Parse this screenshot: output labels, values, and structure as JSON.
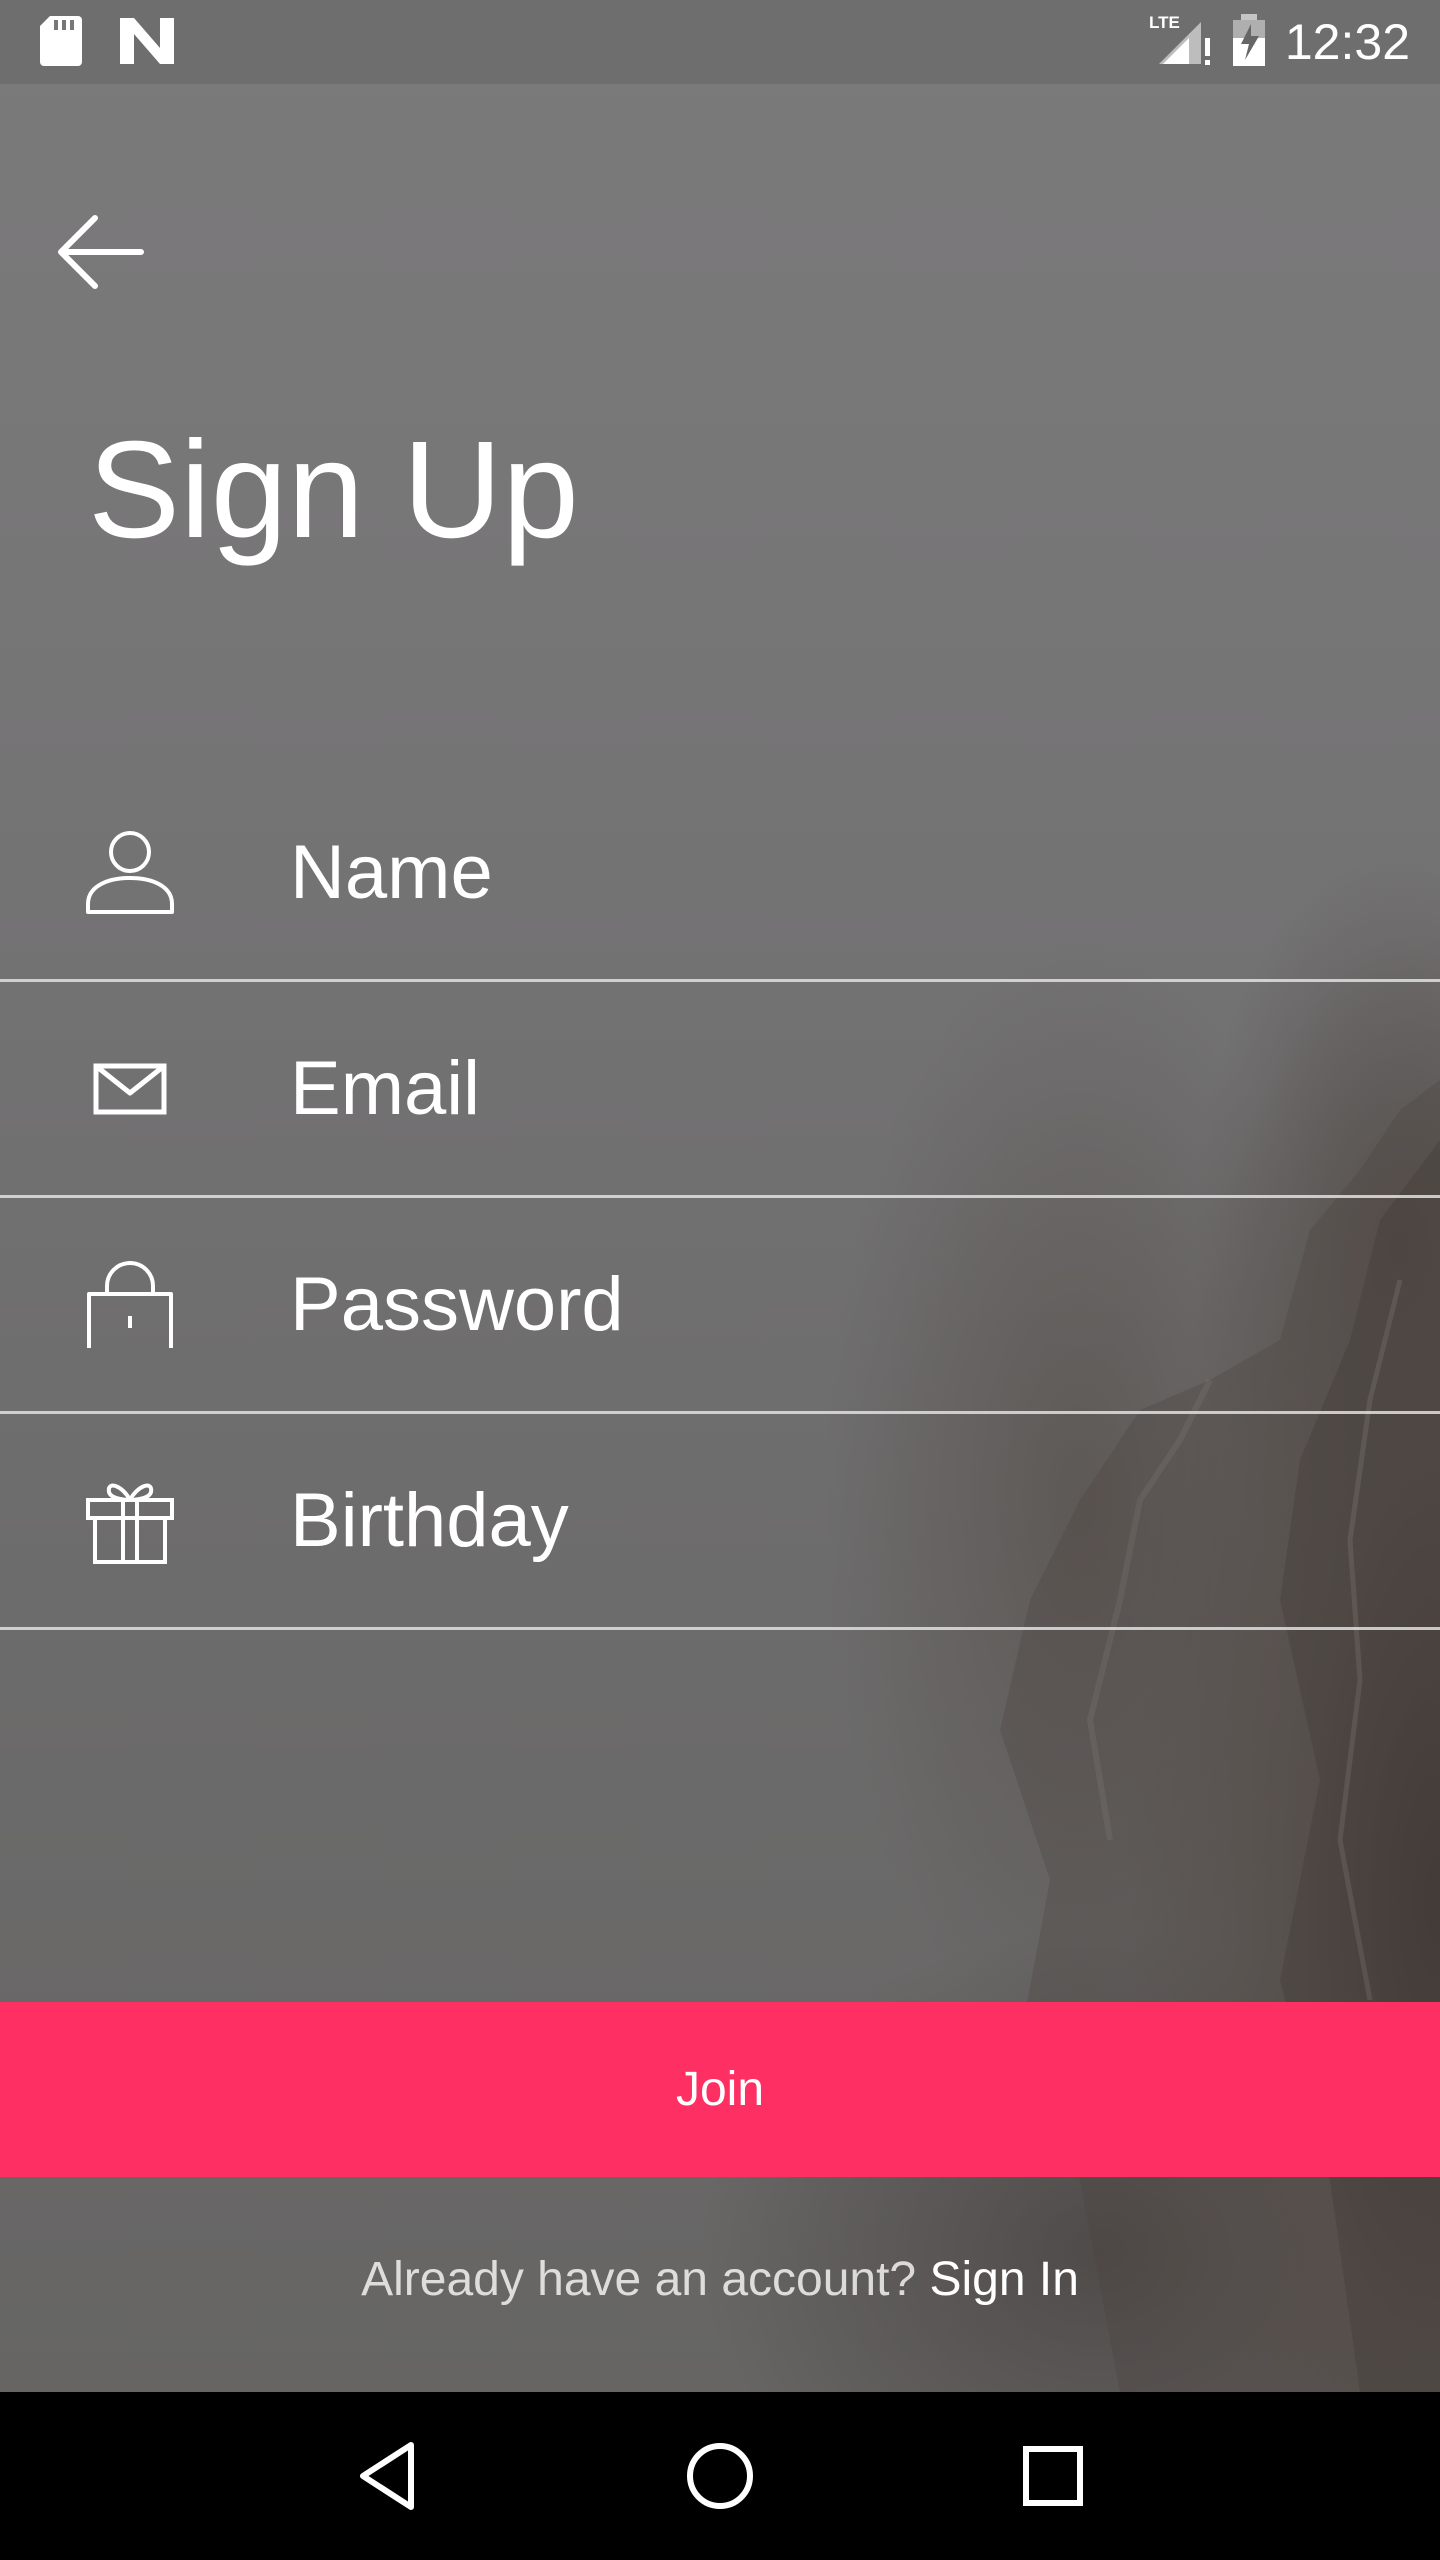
{
  "status_bar": {
    "time": "12:32",
    "network": "LTE",
    "icons": [
      "sd-card-icon",
      "n-logo-icon",
      "lte-signal-icon",
      "battery-charging-icon"
    ]
  },
  "header": {
    "back_icon": "arrow-left-icon",
    "title": "Sign Up"
  },
  "form": {
    "fields": [
      {
        "icon": "person-icon",
        "placeholder": "Name",
        "value": ""
      },
      {
        "icon": "envelope-icon",
        "placeholder": "Email",
        "value": ""
      },
      {
        "icon": "lock-icon",
        "placeholder": "Password",
        "value": ""
      },
      {
        "icon": "gift-icon",
        "placeholder": "Birthday",
        "value": ""
      }
    ]
  },
  "actions": {
    "join_label": "Join",
    "join_color": "#fe2f63",
    "signin_prompt": "Already have an account?",
    "signin_link": "Sign In"
  },
  "nav_bar": {
    "icons": [
      "back-triangle-icon",
      "home-circle-icon",
      "recents-square-icon"
    ]
  }
}
